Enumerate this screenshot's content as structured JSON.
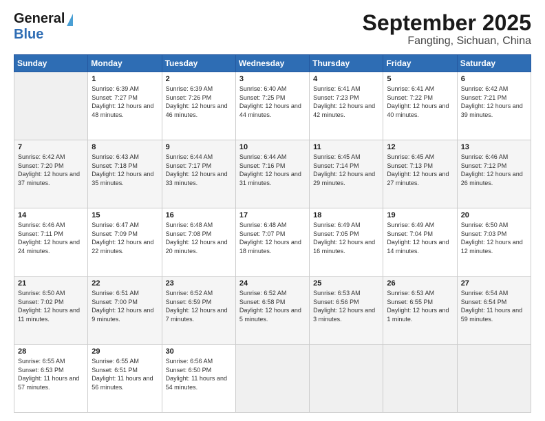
{
  "header": {
    "logo_line1": "General",
    "logo_line2": "Blue",
    "title": "September 2025",
    "subtitle": "Fangting, Sichuan, China"
  },
  "days_of_week": [
    "Sunday",
    "Monday",
    "Tuesday",
    "Wednesday",
    "Thursday",
    "Friday",
    "Saturday"
  ],
  "weeks": [
    [
      {
        "day": "",
        "sunrise": "",
        "sunset": "",
        "daylight": "",
        "empty": true
      },
      {
        "day": "1",
        "sunrise": "Sunrise: 6:39 AM",
        "sunset": "Sunset: 7:27 PM",
        "daylight": "Daylight: 12 hours and 48 minutes."
      },
      {
        "day": "2",
        "sunrise": "Sunrise: 6:39 AM",
        "sunset": "Sunset: 7:26 PM",
        "daylight": "Daylight: 12 hours and 46 minutes."
      },
      {
        "day": "3",
        "sunrise": "Sunrise: 6:40 AM",
        "sunset": "Sunset: 7:25 PM",
        "daylight": "Daylight: 12 hours and 44 minutes."
      },
      {
        "day": "4",
        "sunrise": "Sunrise: 6:41 AM",
        "sunset": "Sunset: 7:23 PM",
        "daylight": "Daylight: 12 hours and 42 minutes."
      },
      {
        "day": "5",
        "sunrise": "Sunrise: 6:41 AM",
        "sunset": "Sunset: 7:22 PM",
        "daylight": "Daylight: 12 hours and 40 minutes."
      },
      {
        "day": "6",
        "sunrise": "Sunrise: 6:42 AM",
        "sunset": "Sunset: 7:21 PM",
        "daylight": "Daylight: 12 hours and 39 minutes."
      }
    ],
    [
      {
        "day": "7",
        "sunrise": "Sunrise: 6:42 AM",
        "sunset": "Sunset: 7:20 PM",
        "daylight": "Daylight: 12 hours and 37 minutes."
      },
      {
        "day": "8",
        "sunrise": "Sunrise: 6:43 AM",
        "sunset": "Sunset: 7:18 PM",
        "daylight": "Daylight: 12 hours and 35 minutes."
      },
      {
        "day": "9",
        "sunrise": "Sunrise: 6:44 AM",
        "sunset": "Sunset: 7:17 PM",
        "daylight": "Daylight: 12 hours and 33 minutes."
      },
      {
        "day": "10",
        "sunrise": "Sunrise: 6:44 AM",
        "sunset": "Sunset: 7:16 PM",
        "daylight": "Daylight: 12 hours and 31 minutes."
      },
      {
        "day": "11",
        "sunrise": "Sunrise: 6:45 AM",
        "sunset": "Sunset: 7:14 PM",
        "daylight": "Daylight: 12 hours and 29 minutes."
      },
      {
        "day": "12",
        "sunrise": "Sunrise: 6:45 AM",
        "sunset": "Sunset: 7:13 PM",
        "daylight": "Daylight: 12 hours and 27 minutes."
      },
      {
        "day": "13",
        "sunrise": "Sunrise: 6:46 AM",
        "sunset": "Sunset: 7:12 PM",
        "daylight": "Daylight: 12 hours and 26 minutes."
      }
    ],
    [
      {
        "day": "14",
        "sunrise": "Sunrise: 6:46 AM",
        "sunset": "Sunset: 7:11 PM",
        "daylight": "Daylight: 12 hours and 24 minutes."
      },
      {
        "day": "15",
        "sunrise": "Sunrise: 6:47 AM",
        "sunset": "Sunset: 7:09 PM",
        "daylight": "Daylight: 12 hours and 22 minutes."
      },
      {
        "day": "16",
        "sunrise": "Sunrise: 6:48 AM",
        "sunset": "Sunset: 7:08 PM",
        "daylight": "Daylight: 12 hours and 20 minutes."
      },
      {
        "day": "17",
        "sunrise": "Sunrise: 6:48 AM",
        "sunset": "Sunset: 7:07 PM",
        "daylight": "Daylight: 12 hours and 18 minutes."
      },
      {
        "day": "18",
        "sunrise": "Sunrise: 6:49 AM",
        "sunset": "Sunset: 7:05 PM",
        "daylight": "Daylight: 12 hours and 16 minutes."
      },
      {
        "day": "19",
        "sunrise": "Sunrise: 6:49 AM",
        "sunset": "Sunset: 7:04 PM",
        "daylight": "Daylight: 12 hours and 14 minutes."
      },
      {
        "day": "20",
        "sunrise": "Sunrise: 6:50 AM",
        "sunset": "Sunset: 7:03 PM",
        "daylight": "Daylight: 12 hours and 12 minutes."
      }
    ],
    [
      {
        "day": "21",
        "sunrise": "Sunrise: 6:50 AM",
        "sunset": "Sunset: 7:02 PM",
        "daylight": "Daylight: 12 hours and 11 minutes."
      },
      {
        "day": "22",
        "sunrise": "Sunrise: 6:51 AM",
        "sunset": "Sunset: 7:00 PM",
        "daylight": "Daylight: 12 hours and 9 minutes."
      },
      {
        "day": "23",
        "sunrise": "Sunrise: 6:52 AM",
        "sunset": "Sunset: 6:59 PM",
        "daylight": "Daylight: 12 hours and 7 minutes."
      },
      {
        "day": "24",
        "sunrise": "Sunrise: 6:52 AM",
        "sunset": "Sunset: 6:58 PM",
        "daylight": "Daylight: 12 hours and 5 minutes."
      },
      {
        "day": "25",
        "sunrise": "Sunrise: 6:53 AM",
        "sunset": "Sunset: 6:56 PM",
        "daylight": "Daylight: 12 hours and 3 minutes."
      },
      {
        "day": "26",
        "sunrise": "Sunrise: 6:53 AM",
        "sunset": "Sunset: 6:55 PM",
        "daylight": "Daylight: 12 hours and 1 minute."
      },
      {
        "day": "27",
        "sunrise": "Sunrise: 6:54 AM",
        "sunset": "Sunset: 6:54 PM",
        "daylight": "Daylight: 11 hours and 59 minutes."
      }
    ],
    [
      {
        "day": "28",
        "sunrise": "Sunrise: 6:55 AM",
        "sunset": "Sunset: 6:53 PM",
        "daylight": "Daylight: 11 hours and 57 minutes."
      },
      {
        "day": "29",
        "sunrise": "Sunrise: 6:55 AM",
        "sunset": "Sunset: 6:51 PM",
        "daylight": "Daylight: 11 hours and 56 minutes."
      },
      {
        "day": "30",
        "sunrise": "Sunrise: 6:56 AM",
        "sunset": "Sunset: 6:50 PM",
        "daylight": "Daylight: 11 hours and 54 minutes."
      },
      {
        "day": "",
        "sunrise": "",
        "sunset": "",
        "daylight": "",
        "empty": true
      },
      {
        "day": "",
        "sunrise": "",
        "sunset": "",
        "daylight": "",
        "empty": true
      },
      {
        "day": "",
        "sunrise": "",
        "sunset": "",
        "daylight": "",
        "empty": true
      },
      {
        "day": "",
        "sunrise": "",
        "sunset": "",
        "daylight": "",
        "empty": true
      }
    ]
  ]
}
